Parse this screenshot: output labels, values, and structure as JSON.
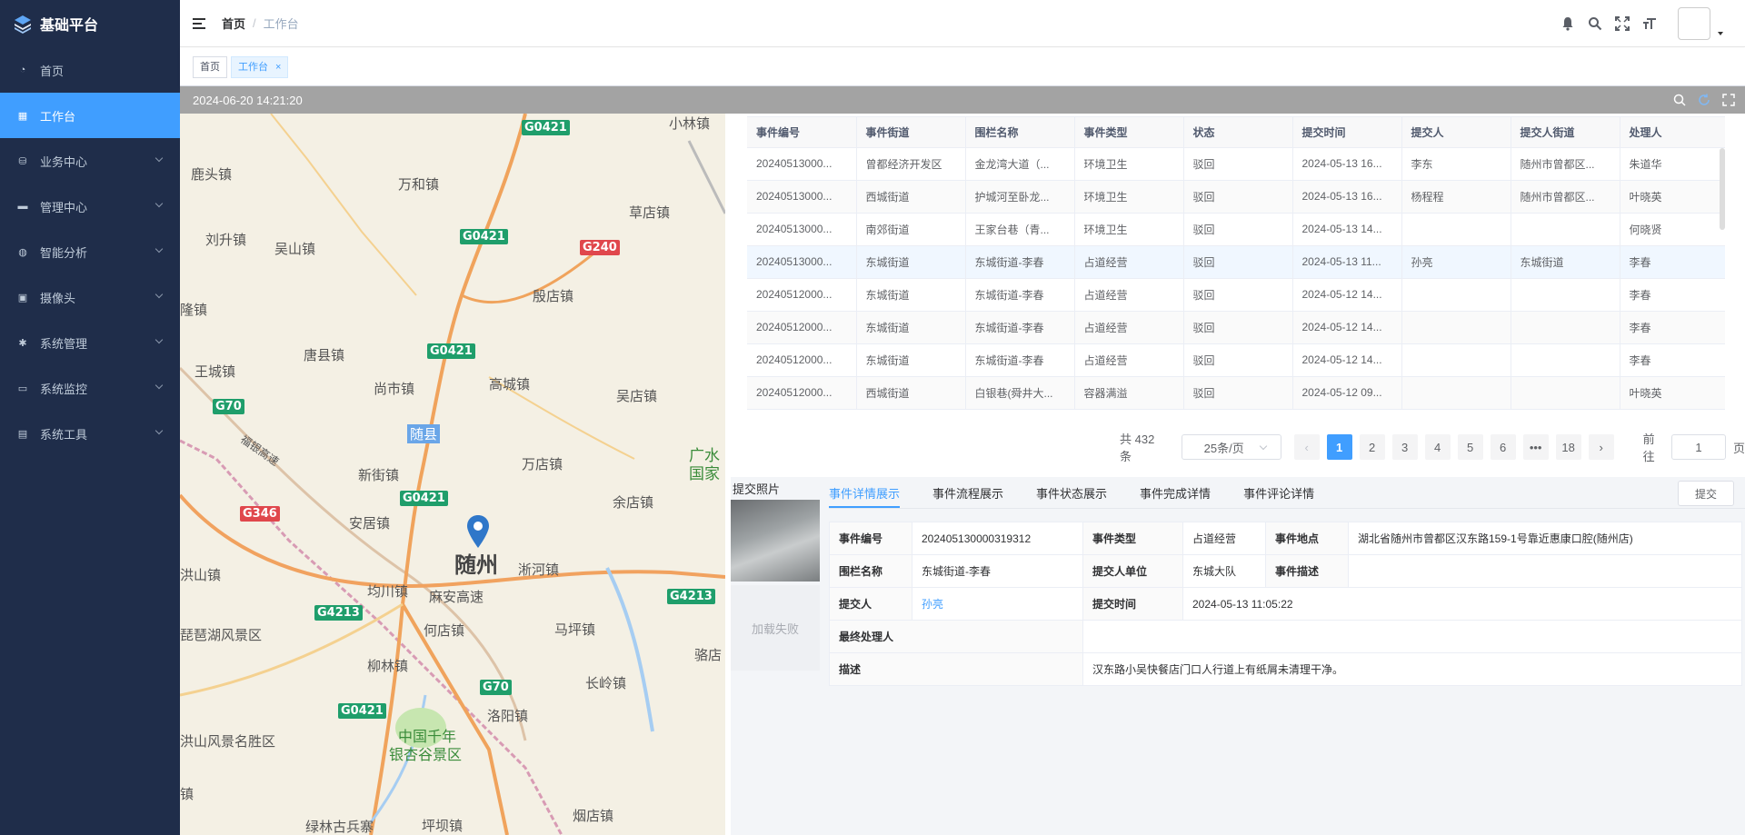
{
  "app": {
    "title": "基础平台"
  },
  "sidebar": {
    "items": [
      {
        "label": "首页",
        "icon": "dashboard-icon",
        "active": false,
        "has_children": false
      },
      {
        "label": "工作台",
        "icon": "grid-icon",
        "active": true,
        "has_children": false
      },
      {
        "label": "业务中心",
        "icon": "database-icon",
        "active": false,
        "has_children": true
      },
      {
        "label": "管理中心",
        "icon": "message-icon",
        "active": false,
        "has_children": true
      },
      {
        "label": "智能分析",
        "icon": "globe-icon",
        "active": false,
        "has_children": true
      },
      {
        "label": "摄像头",
        "icon": "camera-icon",
        "active": false,
        "has_children": true
      },
      {
        "label": "系统管理",
        "icon": "gear-icon",
        "active": false,
        "has_children": true
      },
      {
        "label": "系统监控",
        "icon": "monitor-icon",
        "active": false,
        "has_children": true
      },
      {
        "label": "系统工具",
        "icon": "toolbox-icon",
        "active": false,
        "has_children": true
      }
    ]
  },
  "header": {
    "breadcrumb": {
      "home": "首页",
      "separator": "/",
      "current": "工作台"
    }
  },
  "tags": [
    {
      "label": "首页",
      "active": false,
      "closable": false
    },
    {
      "label": "工作台",
      "active": true,
      "closable": true,
      "close_glyph": "×"
    }
  ],
  "map_panel": {
    "timestamp": "2024-06-20 14:21:20",
    "labels": [
      "小林镇",
      "鹿头镇",
      "万和镇",
      "草店镇",
      "刘升镇",
      "吴山镇",
      "殷店镇",
      "隆镇",
      "唐县镇",
      "王城镇",
      "尚市镇",
      "高城镇",
      "吴店镇",
      "随县",
      "广水",
      "国家",
      "新街镇",
      "万店镇",
      "余店镇",
      "安居镇",
      "随州",
      "淅河镇",
      "洪山镇",
      "均川镇",
      "麻安高速",
      "琵琶湖风景区",
      "何店镇",
      "马坪镇",
      "柳林镇",
      "骆店",
      "长岭镇",
      "洛阳镇",
      "中国千年",
      "银杏谷景区",
      "洪山风景名胜区",
      "镇",
      "绿林古兵寨",
      "坪坝镇",
      "烟店镇",
      "福银高速"
    ],
    "roads": [
      "G0421",
      "G0421",
      "G240",
      "G0421",
      "G70",
      "G0421",
      "G346",
      "G4213",
      "G4213",
      "G70",
      "G0421"
    ]
  },
  "table": {
    "columns": [
      "事件编号",
      "事件街道",
      "围栏名称",
      "事件类型",
      "状态",
      "提交时间",
      "提交人",
      "提交人街道",
      "处理人"
    ],
    "rows": [
      [
        "20240513000...",
        "曾都经济开发区",
        "金龙湾大道（...",
        "环境卫生",
        "驳回",
        "2024-05-13 16...",
        "李东",
        "随州市曾都区...",
        "朱道华"
      ],
      [
        "20240513000...",
        "西城街道",
        "护城河至卧龙...",
        "环境卫生",
        "驳回",
        "2024-05-13 16...",
        "杨程程",
        "随州市曾都区...",
        "叶晓英"
      ],
      [
        "20240513000...",
        "南郊街道",
        "王家台巷（青...",
        "环境卫生",
        "驳回",
        "2024-05-13 14...",
        "",
        "",
        "何晓贤"
      ],
      [
        "20240513000...",
        "东城街道",
        "东城街道-李春",
        "占道经营",
        "驳回",
        "2024-05-13 11...",
        "孙亮",
        "东城街道",
        "李春"
      ],
      [
        "20240512000...",
        "东城街道",
        "东城街道-李春",
        "占道经营",
        "驳回",
        "2024-05-12 14...",
        "",
        "",
        "李春"
      ],
      [
        "20240512000...",
        "东城街道",
        "东城街道-李春",
        "占道经营",
        "驳回",
        "2024-05-12 14...",
        "",
        "",
        "李春"
      ],
      [
        "20240512000...",
        "东城街道",
        "东城街道-李春",
        "占道经营",
        "驳回",
        "2024-05-12 14...",
        "",
        "",
        "李春"
      ],
      [
        "20240512000...",
        "西城街道",
        "白银巷(舜井大...",
        "容器满溢",
        "驳回",
        "2024-05-12 09...",
        "",
        "",
        "叶晓英"
      ]
    ],
    "highlighted_row": 3
  },
  "pagination": {
    "total_text": "共 432 条",
    "page_size": "25条/页",
    "prev": "‹",
    "next": "›",
    "pages": [
      "1",
      "2",
      "3",
      "4",
      "5",
      "6",
      "•••",
      "18"
    ],
    "current_page": "1",
    "goto_label": "前往",
    "goto_value": "1",
    "page_suffix": "页"
  },
  "detail": {
    "photo_title": "提交照片",
    "photo_fail": "加载失败",
    "tabs": [
      "事件详情展示",
      "事件流程展示",
      "事件状态展示",
      "事件完成详情",
      "事件评论详情"
    ],
    "active_tab": 0,
    "submit_label": "提交",
    "fields": {
      "event_no_label": "事件编号",
      "event_no": "202405130000319312",
      "event_type_label": "事件类型",
      "event_type": "占道经营",
      "event_location_label": "事件地点",
      "event_location": "湖北省随州市曾都区汉东路159-1号靠近惠康口腔(随州店)",
      "fence_label": "围栏名称",
      "fence": "东城街道-李春",
      "submit_unit_label": "提交人单位",
      "submit_unit": "东城大队",
      "event_desc_label": "事件描述",
      "event_desc": "",
      "submitter_label": "提交人",
      "submitter": "孙亮",
      "submit_time_label": "提交时间",
      "submit_time": "2024-05-13 11:05:22",
      "final_handler_label": "最终处理人",
      "final_handler": "",
      "description_label": "描述",
      "description": "汉东路小吴快餐店门口人行道上有纸屑未清理干净。"
    }
  },
  "colors": {
    "sidebar_bg": "#1f2d4a",
    "accent": "#409eff",
    "map_header": "#a3a3a3"
  }
}
